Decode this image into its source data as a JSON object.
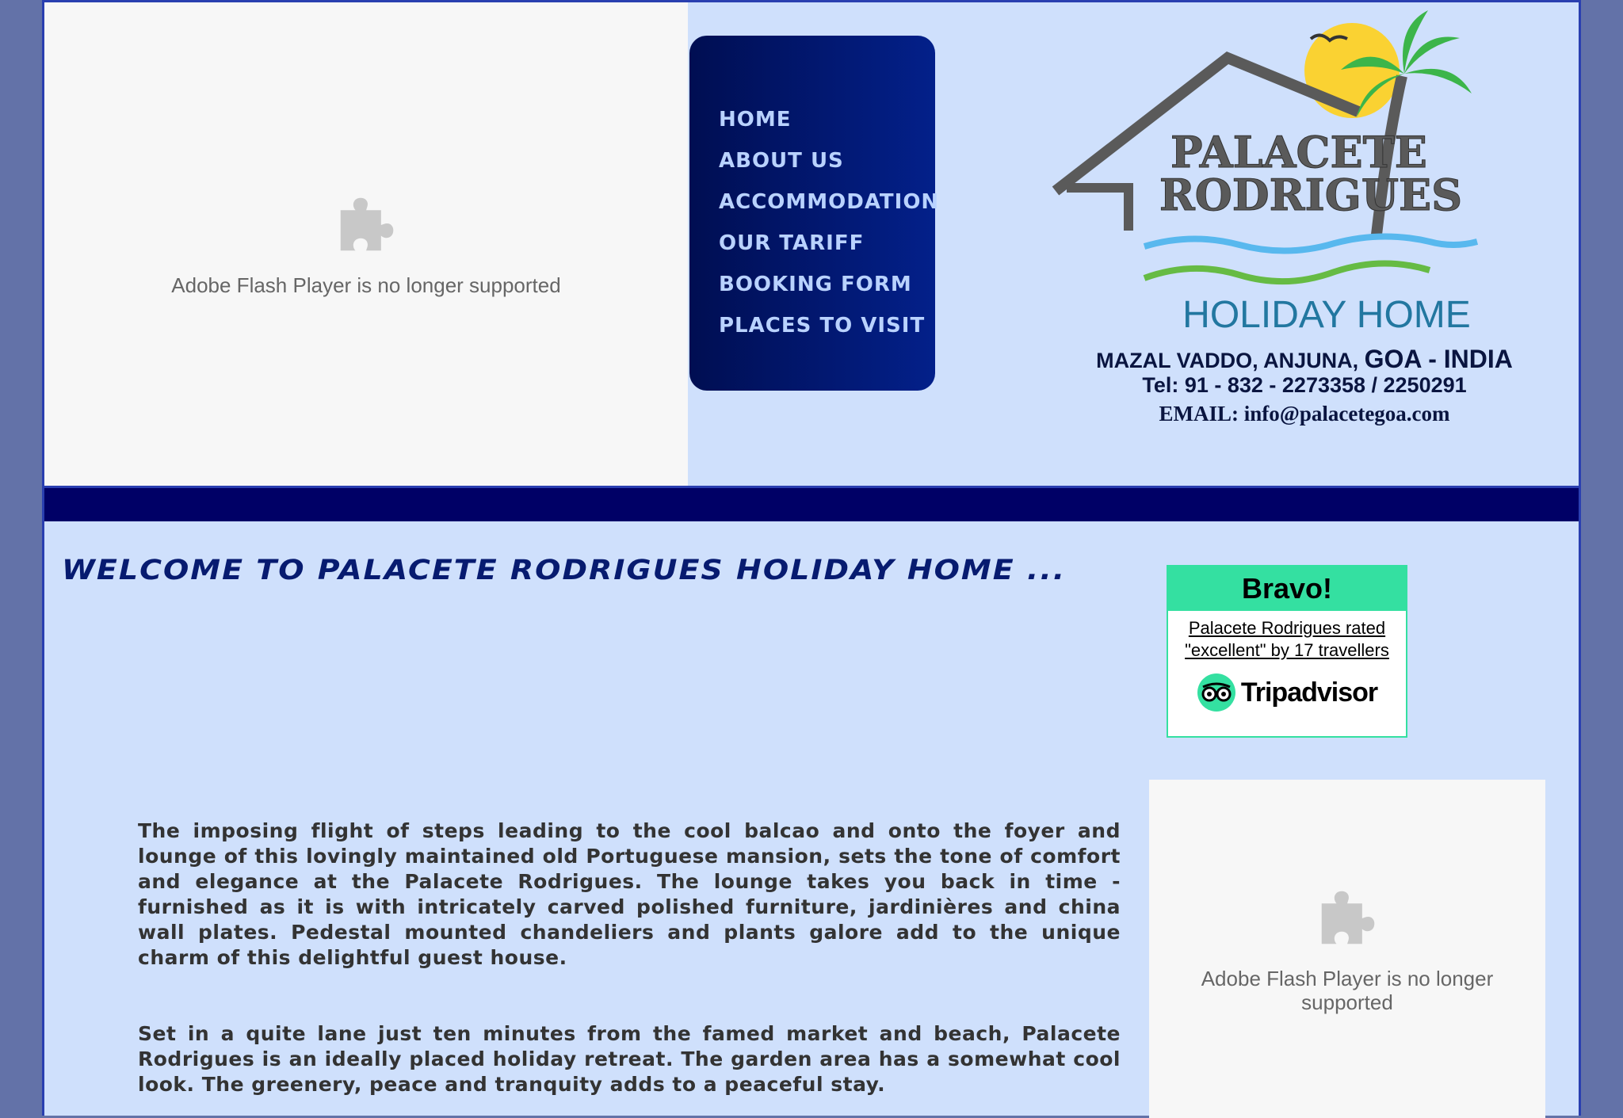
{
  "flash_top": {
    "message": "Adobe Flash Player is no longer supported"
  },
  "nav": {
    "items": [
      {
        "label": "HOME"
      },
      {
        "label": "ABOUT US"
      },
      {
        "label": "ACCOMMODATION"
      },
      {
        "label": "OUR TARIFF"
      },
      {
        "label": "BOOKING FORM"
      },
      {
        "label": "PLACES TO VISIT"
      }
    ]
  },
  "logo": {
    "name_line1": "PALACETE",
    "name_line2": "RODRIGUES",
    "tagline": "HOLIDAY HOME"
  },
  "contact": {
    "address_prefix": "MAZAL VADDO, ANJUNA,",
    "address_region": "GOA - INDIA",
    "tel": "Tel: 91 - 832 - 2273358 / 2250291",
    "email": "EMAIL: info@palacetegoa.com"
  },
  "welcome": {
    "heading": "Welcome to Palacete Rodrigues Holiday Home ..."
  },
  "tripadvisor": {
    "badge_title": "Bravo!",
    "review_link": "Palacete Rodrigues rated \"excellent\" by 17 travellers",
    "brand": "Tripadvisor",
    "brand_color": "#34e0a1"
  },
  "content": {
    "paragraph1": "The imposing flight of steps leading to the cool balcao and onto the foyer and lounge of this lovingly maintained old Portuguese mansion, sets the tone of comfort and elegance at the Palacete Rodrigues. The lounge takes you back in time - furnished as it is with intricately carved polished furniture, jardinières and china wall plates. Pedestal mounted chandeliers and plants galore add to the unique charm of this delightful guest house.",
    "paragraph2": "Set in a quite lane just ten minutes from the famed market and beach, Palacete Rodrigues is an ideally placed holiday retreat. The garden area has a somewhat cool look. The greenery, peace and tranquity adds to a peaceful stay."
  },
  "flash_side": {
    "message": "Adobe Flash Player is no longer supported"
  },
  "colors": {
    "background": "#6372a8",
    "page": "#cfe0fc",
    "nav_dark": "#000e52",
    "nav_text": "#b9d2ff",
    "divider_bar": "#000066"
  }
}
